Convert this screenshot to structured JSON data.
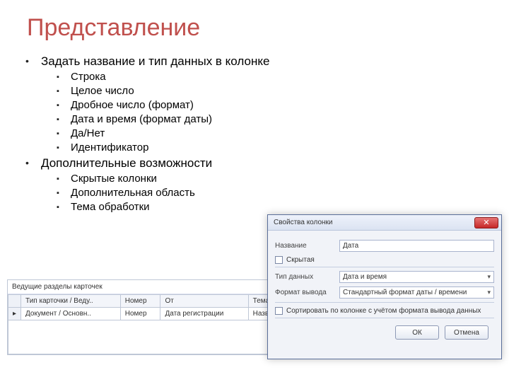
{
  "slide": {
    "title": "Представление",
    "bullet1": "Задать название и тип данных в колонке",
    "types": [
      "Строка",
      "Целое число",
      "Дробное число (формат)",
      "Дата и время (формат даты)",
      "Да/Нет",
      "Идентификатор"
    ],
    "bullet2": "Дополнительные возможности",
    "extras": [
      "Скрытые колонки",
      "Дополнительная область",
      "Тема обработки"
    ]
  },
  "left_panel": {
    "caption": "Ведущие разделы карточек",
    "headers": [
      "",
      "Тип карточки / Веду..",
      "Номер",
      "От",
      "Тема"
    ],
    "row": [
      "▸",
      "Документ / Основн..",
      "Номер",
      "Дата регистрации",
      "Назв"
    ]
  },
  "dialog": {
    "title": "Свойства колонки",
    "labels": {
      "name": "Название",
      "hidden": "Скрытая",
      "type": "Тип данных",
      "format": "Формат вывода"
    },
    "values": {
      "name": "Дата",
      "type": "Дата и время",
      "format": "Стандартный формат даты / времени"
    },
    "sort_checkbox": "Сортировать по колонке с учётом формата вывода данных",
    "buttons": {
      "ok": "ОК",
      "cancel": "Отмена"
    }
  }
}
